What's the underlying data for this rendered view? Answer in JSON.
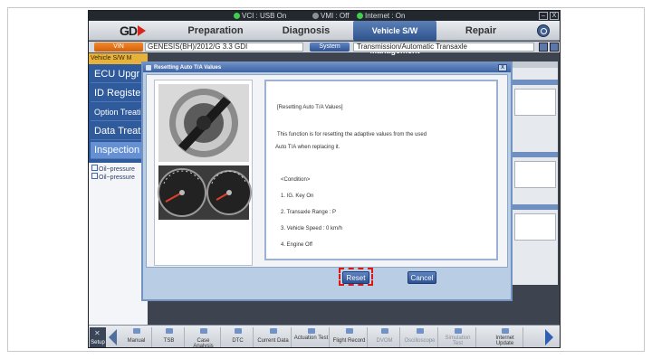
{
  "status": {
    "vci": "VCI : USB On",
    "vmi": "VMI : Off",
    "internet": "Internet : On"
  },
  "window": {
    "minimize": "–",
    "close": "X"
  },
  "menu": {
    "logo": "GD",
    "tabs": [
      "Preparation",
      "Diagnosis",
      "Vehicle S/W Management",
      "Repair"
    ]
  },
  "vehicle": {
    "vin_button": "VIN",
    "name": "GENESIS(BH)/2012/G 3.3 GDI",
    "system_button": "System",
    "system_value": "Transmission/Automatic Transaxle"
  },
  "sidebar": {
    "header": "Vehicle S/W M",
    "items": [
      "ECU Upgr",
      "ID Registe",
      "Option Treati",
      "Data Treatn",
      "Inspection /"
    ],
    "sub_items": [
      "Oil−pressure",
      "Oil−pressure"
    ]
  },
  "dialog": {
    "title": "Resetting Auto T/A Values",
    "close": "X",
    "lines": [
      "[Resetting Auto T/A Values]",
      "This function is for resetting the adaptive values from the used",
      "Auto T/A when replacing it.",
      "<Condition>",
      "1. IG. Key On",
      "2. Transaxle Range : P",
      "3. Vehicle Speed : 0 km/h",
      "4. Engine Off"
    ],
    "reset_label": "Reset",
    "cancel_label": "Cancel"
  },
  "toolbar": {
    "setup": "Setup",
    "items": [
      {
        "label": "Manual",
        "enabled": true
      },
      {
        "label": "TSB",
        "enabled": true
      },
      {
        "label": "Case Analysis",
        "enabled": true
      },
      {
        "label": "DTC",
        "enabled": true
      },
      {
        "label": "Current Data",
        "enabled": true
      },
      {
        "label": "Actuation Test",
        "enabled": true
      },
      {
        "label": "Flight Record",
        "enabled": true
      },
      {
        "label": "DVOM",
        "enabled": false
      },
      {
        "label": "Oscilloscope",
        "enabled": false
      },
      {
        "label": "Simulation Test",
        "enabled": false
      },
      {
        "label": "Internet Update",
        "enabled": true
      }
    ]
  },
  "colors": {
    "accent": "#2f538d",
    "highlight": "#e01616",
    "status_on": "#3fcf4a"
  }
}
